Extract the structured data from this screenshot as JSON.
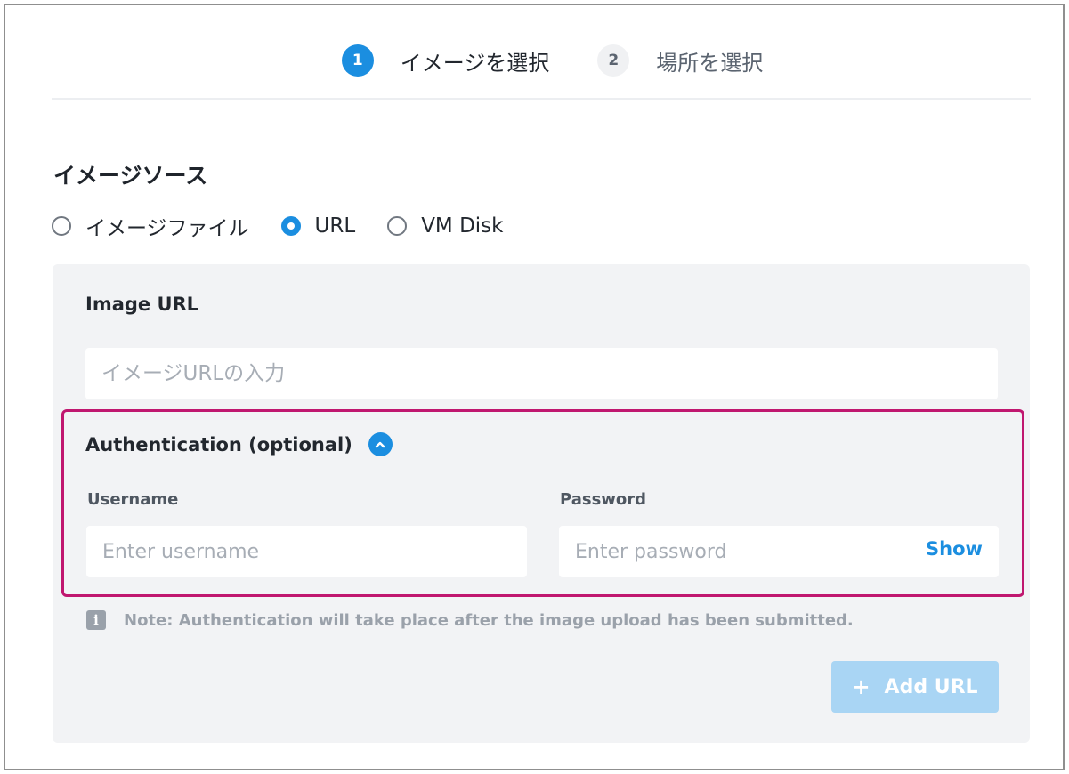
{
  "stepper": {
    "steps": [
      {
        "number": "1",
        "label": "イメージを選択",
        "state": "active"
      },
      {
        "number": "2",
        "label": "場所を選択",
        "state": "inactive"
      }
    ]
  },
  "image_source": {
    "title": "イメージソース",
    "options": [
      {
        "label": "イメージファイル",
        "checked": false
      },
      {
        "label": "URL",
        "checked": true
      },
      {
        "label": "VM Disk",
        "checked": false
      }
    ]
  },
  "image_url": {
    "title": "Image URL",
    "placeholder": "イメージURLの入力",
    "value": ""
  },
  "authentication": {
    "title": "Authentication (optional)",
    "username_label": "Username",
    "username_placeholder": "Enter username",
    "password_label": "Password",
    "password_placeholder": "Enter password",
    "show_label": "Show"
  },
  "note": {
    "icon": "info-icon",
    "text": "Note: Authentication will take place after the image upload has been submitted."
  },
  "add_button": {
    "icon": "plus-icon",
    "label": "Add URL"
  },
  "colors": {
    "accent": "#1b8ee0",
    "highlight_border": "#c0176f",
    "panel_bg": "#f2f3f5",
    "disabled_button": "#a9d5f4"
  }
}
